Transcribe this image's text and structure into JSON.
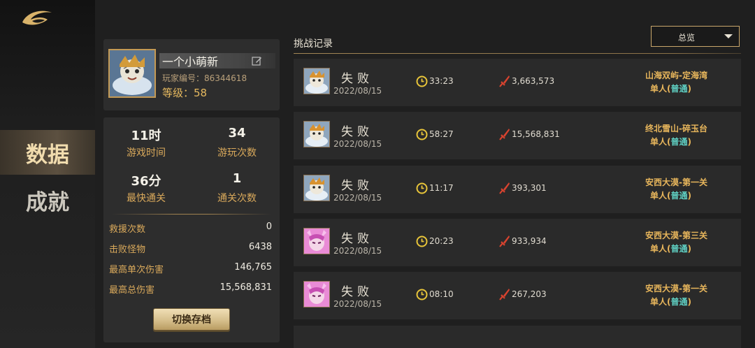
{
  "sidebar": {
    "tabs": [
      {
        "label": "数据",
        "active": true
      },
      {
        "label": "成就",
        "active": false
      }
    ]
  },
  "profile": {
    "name": "一个小萌新",
    "player_id": "玩家编号：86344618",
    "level": "等级：58"
  },
  "stats": {
    "play_time": {
      "value": "11时",
      "label": "游戏时间"
    },
    "play_count": {
      "value": "34",
      "label": "游玩次数"
    },
    "fastest_clear": {
      "value": "36分",
      "label": "最快通关"
    },
    "clear_count": {
      "value": "1",
      "label": "通关次数"
    },
    "rows": [
      {
        "label": "救援次数",
        "value": "0"
      },
      {
        "label": "击败怪物",
        "value": "6438"
      },
      {
        "label": "最高单次伤害",
        "value": "146,765"
      },
      {
        "label": "最高总伤害",
        "value": "15,568,831"
      }
    ],
    "switch_button": "切换存档"
  },
  "records": {
    "title": "挑战记录",
    "filter_selected": "总览",
    "items": [
      {
        "result": "失败",
        "date": "2022/08/15",
        "time": "33:23",
        "damage": "3,663,573",
        "stage": "山海双屿-定海湾",
        "mode_prefix": "单人(",
        "difficulty": "普通",
        "mode_suffix": ")",
        "avatar": "tiger-hero"
      },
      {
        "result": "失败",
        "date": "2022/08/15",
        "time": "58:27",
        "damage": "15,568,831",
        "stage": "终北雪山-碎玉台",
        "mode_prefix": "单人(",
        "difficulty": "普通",
        "mode_suffix": ")",
        "avatar": "tiger-hero"
      },
      {
        "result": "失败",
        "date": "2022/08/15",
        "time": "11:17",
        "damage": "393,301",
        "stage": "安西大漠-第一关",
        "mode_prefix": "单人(",
        "difficulty": "普通",
        "mode_suffix": ")",
        "avatar": "tiger-hero"
      },
      {
        "result": "失败",
        "date": "2022/08/15",
        "time": "20:23",
        "damage": "933,934",
        "stage": "安西大漠-第三关",
        "mode_prefix": "单人(",
        "difficulty": "普通",
        "mode_suffix": ")",
        "avatar": "fox-hero"
      },
      {
        "result": "失败",
        "date": "2022/08/15",
        "time": "08:10",
        "damage": "267,203",
        "stage": "安西大漠-第一关",
        "mode_prefix": "单人(",
        "difficulty": "普通",
        "mode_suffix": ")",
        "avatar": "fox-hero"
      }
    ]
  },
  "colors": {
    "accent_gold": "#e9b75c",
    "difficulty_teal": "#5fd0c3",
    "damage_red": "#d8432f",
    "clock_yellow": "#e8c53a"
  }
}
